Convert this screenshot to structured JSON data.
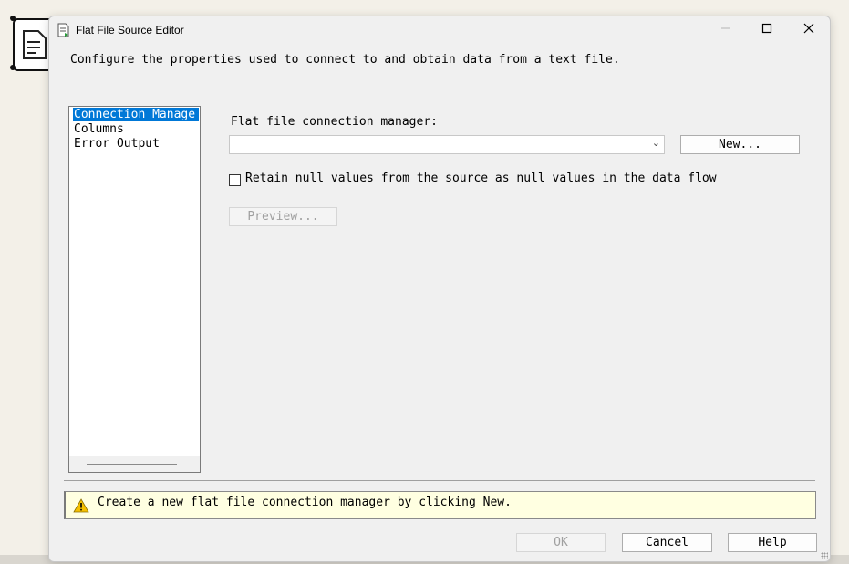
{
  "window": {
    "title": "Flat File Source Editor",
    "description": "Configure the properties used to connect to and obtain data from a text file."
  },
  "pages": [
    {
      "label": "Connection Manage",
      "selected": true
    },
    {
      "label": "Columns",
      "selected": false
    },
    {
      "label": "Error Output",
      "selected": false
    }
  ],
  "connection": {
    "label": "Flat file connection manager:",
    "selected_value": "",
    "new_button": "New..."
  },
  "retain_nulls": {
    "label": "Retain null values from the source as null values in the data flow",
    "checked": false
  },
  "preview_button": "Preview...",
  "message": {
    "text": "Create a new flat file connection manager by clicking New."
  },
  "footer": {
    "ok": "OK",
    "cancel": "Cancel",
    "help": "Help"
  },
  "icons": {
    "app": "flat-file-icon",
    "warning": "warning-icon"
  },
  "colors": {
    "selection": "#0078d7",
    "message_bg": "#ffffe1",
    "warning": "#f5c000"
  }
}
